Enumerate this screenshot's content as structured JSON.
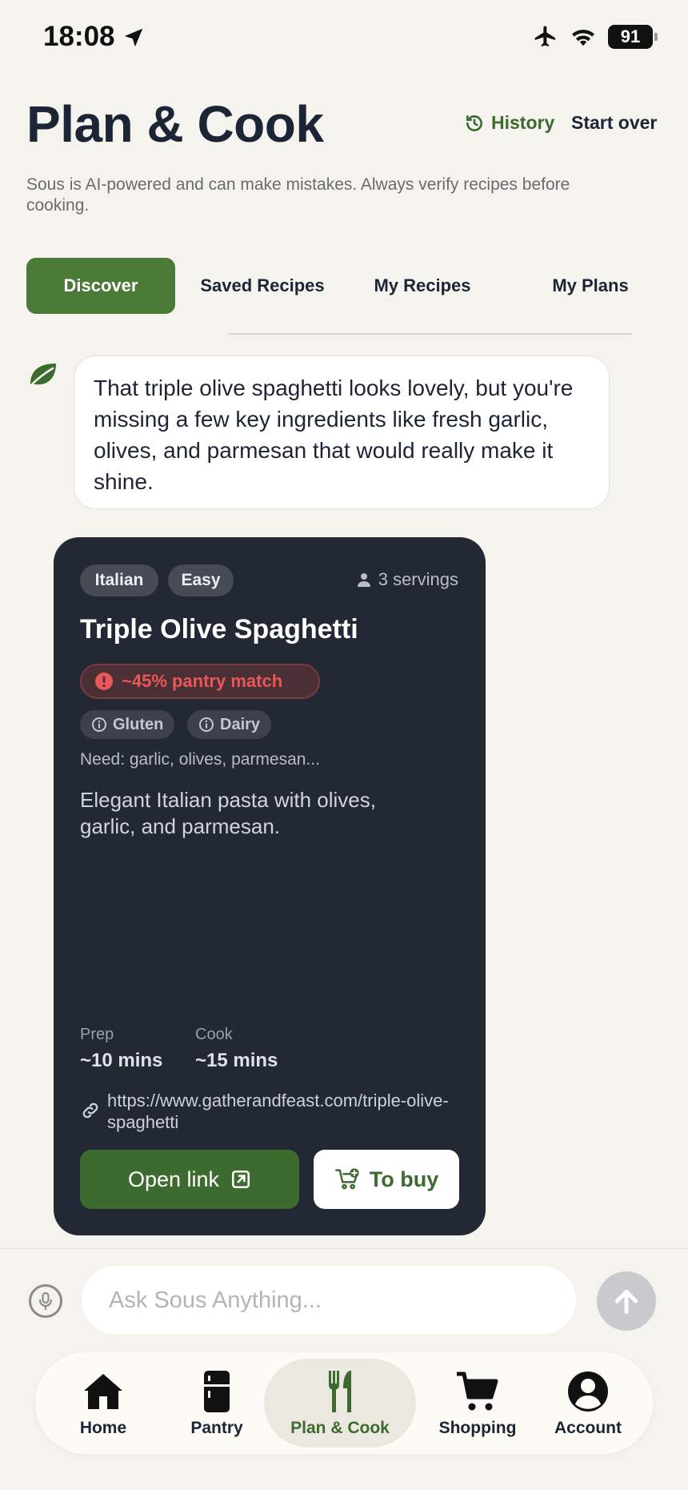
{
  "status": {
    "time": "18:08",
    "battery": "91"
  },
  "header": {
    "title": "Plan & Cook",
    "history_label": "History",
    "start_over_label": "Start over",
    "disclaimer": "Sous is AI-powered and can make mistakes. Always verify recipes before cooking."
  },
  "tabs": [
    {
      "label": "Discover",
      "active": true
    },
    {
      "label": "Saved Recipes",
      "active": false
    },
    {
      "label": "My Recipes",
      "active": false
    },
    {
      "label": "My Plans",
      "active": false
    }
  ],
  "chat": {
    "message": "That triple olive spaghetti looks lovely, but you're missing a few key ingredients like fresh garlic, olives, and parmesan that would really make it shine."
  },
  "recipe": {
    "tags": [
      "Italian",
      "Easy"
    ],
    "servings": "3 servings",
    "title": "Triple Olive Spaghetti",
    "pantry_match": "~45% pantry match",
    "allergens": [
      "Gluten",
      "Dairy"
    ],
    "need": "Need: garlic, olives, parmesan...",
    "description": "Elegant Italian pasta with olives, garlic, and parmesan.",
    "prep_label": "Prep",
    "prep_value": "~10 mins",
    "cook_label": "Cook",
    "cook_value": "~15 mins",
    "link": "https://www.gatherandfeast.com/triple-olive-spaghetti",
    "open_link_label": "Open link",
    "to_buy_label": "To buy"
  },
  "input": {
    "placeholder": "Ask Sous Anything..."
  },
  "nav": [
    {
      "label": "Home",
      "icon": "home-icon"
    },
    {
      "label": "Pantry",
      "icon": "fridge-icon"
    },
    {
      "label": "Plan & Cook",
      "icon": "utensils-icon",
      "active": true
    },
    {
      "label": "Shopping",
      "icon": "cart-icon"
    },
    {
      "label": "Account",
      "icon": "account-icon"
    }
  ],
  "colors": {
    "background": "#f5f3ed",
    "accent_green": "#3d6b2f",
    "card_dark": "#232835",
    "warning_red": "#e8585a"
  }
}
